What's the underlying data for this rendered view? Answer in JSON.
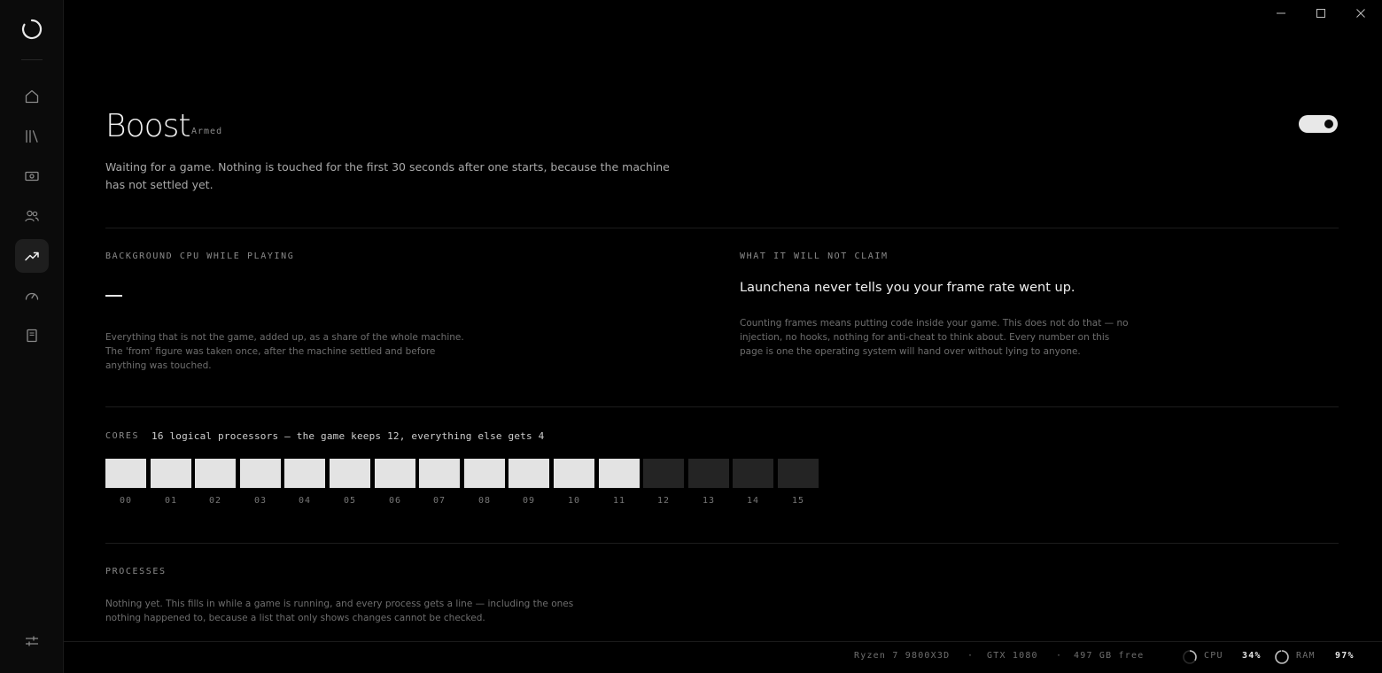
{
  "boost": {
    "title": "Boost",
    "status": "Armed",
    "description": "Waiting for a game. Nothing is touched for the first 30 seconds after one starts, because the machine has not settled yet.",
    "toggle_on": true
  },
  "background_cpu": {
    "label": "BACKGROUND CPU WHILE PLAYING",
    "value": "—",
    "note": "Everything that is not the game, added up, as a share of the whole machine. The 'from' figure was taken once, after the machine settled and before anything was touched."
  },
  "claim": {
    "label": "WHAT IT WILL NOT CLAIM",
    "headline": "Launchena never tells you your frame rate went up.",
    "body": "Counting frames means putting code inside your game. This does not do that — no injection, no hooks, nothing for anti-cheat to think about. Every number on this page is one the operating system will hand over without lying to anyone."
  },
  "cores": {
    "label": "CORES",
    "summary": "16 logical processors — the game keeps 12, everything else gets 4",
    "items": [
      {
        "id": "00",
        "game": true
      },
      {
        "id": "01",
        "game": true
      },
      {
        "id": "02",
        "game": true
      },
      {
        "id": "03",
        "game": true
      },
      {
        "id": "04",
        "game": true
      },
      {
        "id": "05",
        "game": true
      },
      {
        "id": "06",
        "game": true
      },
      {
        "id": "07",
        "game": true
      },
      {
        "id": "08",
        "game": true
      },
      {
        "id": "09",
        "game": true
      },
      {
        "id": "10",
        "game": true
      },
      {
        "id": "11",
        "game": true
      },
      {
        "id": "12",
        "game": false
      },
      {
        "id": "13",
        "game": false
      },
      {
        "id": "14",
        "game": false
      },
      {
        "id": "15",
        "game": false
      }
    ]
  },
  "processes": {
    "label": "PROCESSES",
    "note": "Nothing yet. This fills in while a game is running, and every process gets a line — including the ones nothing happened to, because a list that only shows changes cannot be checked."
  },
  "statusbar": {
    "cpu_model": "Ryzen 7 9800X3D",
    "gpu_model": "GTX 1080",
    "disk_free": "497 GB free",
    "separator": "·",
    "cpu_label": "CPU",
    "cpu_value": "34%",
    "cpu_fraction": 0.34,
    "ram_label": "RAM",
    "ram_value": "97%",
    "ram_fraction": 0.97
  },
  "icons": {
    "logo": "launcher-logo-icon",
    "nav": [
      "home-icon",
      "library-icon",
      "wallet-icon",
      "friends-icon",
      "trend-up-icon",
      "gauge-icon",
      "document-icon"
    ],
    "settings": "sliders-icon"
  },
  "colors": {
    "background": "#000000",
    "sidebar": "#0b0b0b",
    "core_game": "#e3e3e3",
    "core_other": "#242424",
    "text": "#e6e6e6"
  }
}
